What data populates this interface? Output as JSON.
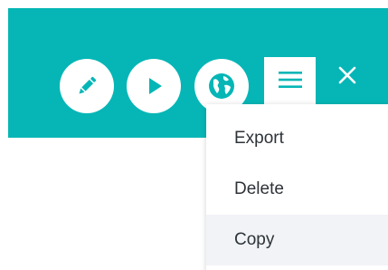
{
  "toolbar": {
    "background_color": "#06b6b6",
    "buttons": [
      {
        "icon": "pencil-icon"
      },
      {
        "icon": "play-icon"
      },
      {
        "icon": "globe-icon"
      },
      {
        "icon": "hamburger-menu-icon"
      },
      {
        "icon": "close-icon"
      }
    ]
  },
  "menu": {
    "items": [
      {
        "label": "Export"
      },
      {
        "label": "Delete"
      },
      {
        "label": "Copy",
        "hovered": true
      }
    ]
  }
}
